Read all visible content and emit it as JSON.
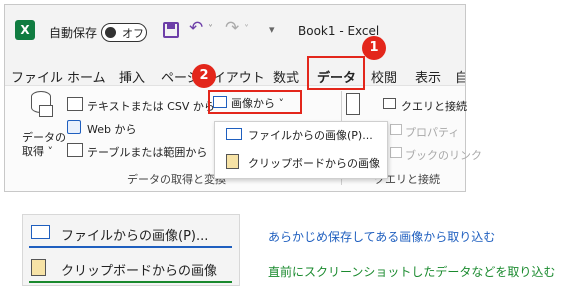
{
  "titlebar": {
    "app_icon": "excel-logo-icon",
    "app_letter": "X",
    "autosave_label": "自動保存",
    "autosave_state": "オフ",
    "save_icon": "save-icon",
    "undo_icon": "undo-icon",
    "redo_icon": "redo-icon",
    "qat_more": "▾",
    "doc_title": "Book1 - Excel"
  },
  "tabs": [
    {
      "label": "ファイル"
    },
    {
      "label": "ホーム"
    },
    {
      "label": "挿入"
    },
    {
      "label": "ページレイアウト"
    },
    {
      "label": "数式"
    },
    {
      "label": "データ",
      "active": true
    },
    {
      "label": "校閲"
    },
    {
      "label": "表示"
    },
    {
      "label": "自動"
    }
  ],
  "ribbon": {
    "get_data_label_1": "データの",
    "get_data_label_2": "取得 ˅",
    "from_text_csv": "テキストまたは CSV から",
    "from_web": "Web から",
    "from_table_range": "テーブルまたは範囲から",
    "from_picture": "画像から ˅",
    "group_get_transform": "データの取得と変換",
    "queries_connections": "クエリと接続",
    "properties": "プロパティ",
    "edit_links": "ブックのリンク",
    "group_queries": "クエリと接続"
  },
  "dropdown": {
    "item_file": "ファイルからの画像(P)...",
    "item_clipboard": "クリップボードからの画像"
  },
  "badges": {
    "one": "1",
    "two": "2"
  },
  "callout": {
    "item_file": "ファイルからの画像(P)...",
    "item_clipboard": "クリップボードからの画像",
    "note_file": "あらかじめ保存してある画像から取り込む",
    "note_clipboard": "直前にスクリーンショットしたデータなどを取り込む"
  },
  "colors": {
    "excel_green": "#107c41",
    "highlight_red": "#e3261b",
    "note_blue": "#1f5fbf",
    "note_green": "#1a8a2e"
  }
}
